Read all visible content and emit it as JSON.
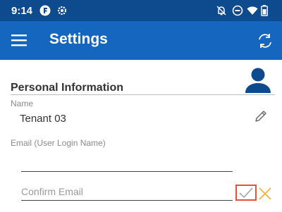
{
  "status_bar": {
    "time": "9:14",
    "left_icons": [
      "f-app-icon",
      "gear-icon"
    ],
    "right_icons": [
      "bell-off-icon",
      "do-not-disturb-icon",
      "wifi-icon",
      "battery-icon"
    ]
  },
  "app_bar": {
    "title": "Settings",
    "menu_icon": "hamburger-menu-icon",
    "action_icon": "sync-icon"
  },
  "personal_info": {
    "section_title": "Personal Information",
    "avatar_icon": "person-icon",
    "name_label": "Name",
    "name_value": "Tenant 03",
    "edit_icon": "pencil-icon",
    "email_label": "Email (User Login Name)",
    "email_value": "",
    "confirm_email_placeholder": "Confirm Email"
  },
  "colors": {
    "status_bar": "#0e4a8e",
    "app_bar": "#1566bf",
    "accent": "#1566bf",
    "confirm_border": "#e8503a",
    "cancel_x": "#f0b23a"
  }
}
